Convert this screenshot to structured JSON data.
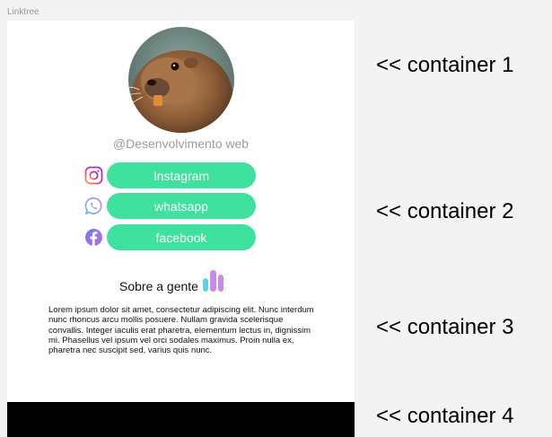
{
  "frame_label": "Linktree",
  "profile": {
    "username": "@Desenvolvimento web"
  },
  "links": [
    {
      "label": "Instagram",
      "icon": "instagram-icon"
    },
    {
      "label": "whatsapp",
      "icon": "whatsapp-icon"
    },
    {
      "label": "facebook",
      "icon": "facebook-icon"
    }
  ],
  "about": {
    "title": "Sobre a gente",
    "icon": "bar-chart-icon",
    "text": "Lorem ipsum dolor sit amet, consectetur adipiscing elit. Nunc interdum nunc rhoncus arcu mollis posuere. Nullam gravida scelerisque convallis. Integer iaculis erat pharetra, elementum lectus in, dignissim mi. Phasellus vel ipsum vel orci sodales maximus. Proin nulla ex, pharetra nec suscipit sed, varius quis nunc."
  },
  "annotations": [
    "<< container 1",
    "<< container 2",
    "<< container 3",
    "<< container 4"
  ],
  "colors": {
    "button": "#3ee19d",
    "button_text": "#ffffff",
    "username": "#9b9b9b",
    "footer": "#000000",
    "page_bg": "#f3f3f3"
  }
}
